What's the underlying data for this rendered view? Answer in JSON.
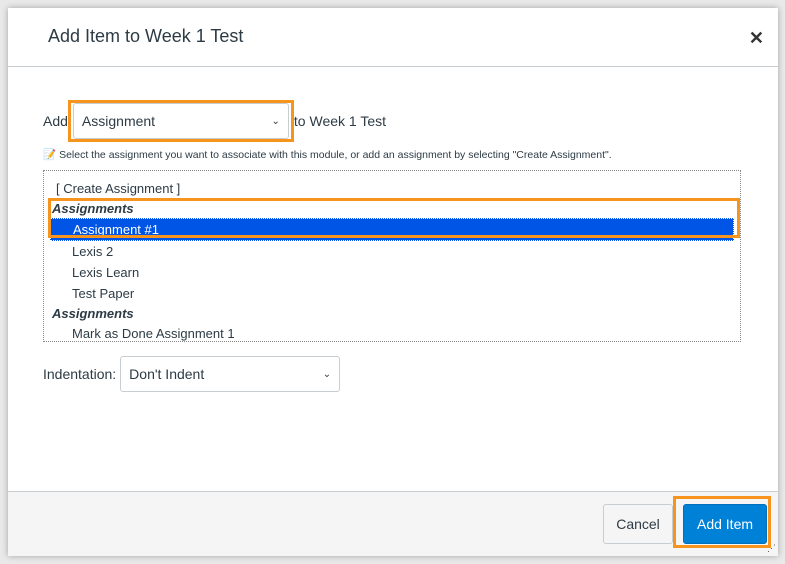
{
  "dialog": {
    "title": "Add Item to Week 1 Test",
    "close_icon": "close-icon"
  },
  "add_row": {
    "prefix": "Add",
    "type_value": "Assignment",
    "suffix": "to Week 1 Test"
  },
  "hint": "Select the assignment you want to associate with this module, or add an assignment by selecting \"Create Assignment\".",
  "list": {
    "create": "[ Create Assignment ]",
    "groups": [
      {
        "label": "Assignments",
        "items": [
          "Assignment #1",
          "Lexis 2",
          "Lexis Learn",
          "Test Paper"
        ]
      },
      {
        "label": "Assignments",
        "items": [
          "Mark as Done Assignment 1"
        ]
      }
    ],
    "selected": "Assignment #1"
  },
  "indentation": {
    "label": "Indentation:",
    "value": "Don't Indent"
  },
  "footer": {
    "cancel": "Cancel",
    "add": "Add Item"
  },
  "colors": {
    "highlight": "#f7941d",
    "selection": "#0055e6",
    "primary": "#0081d8"
  }
}
